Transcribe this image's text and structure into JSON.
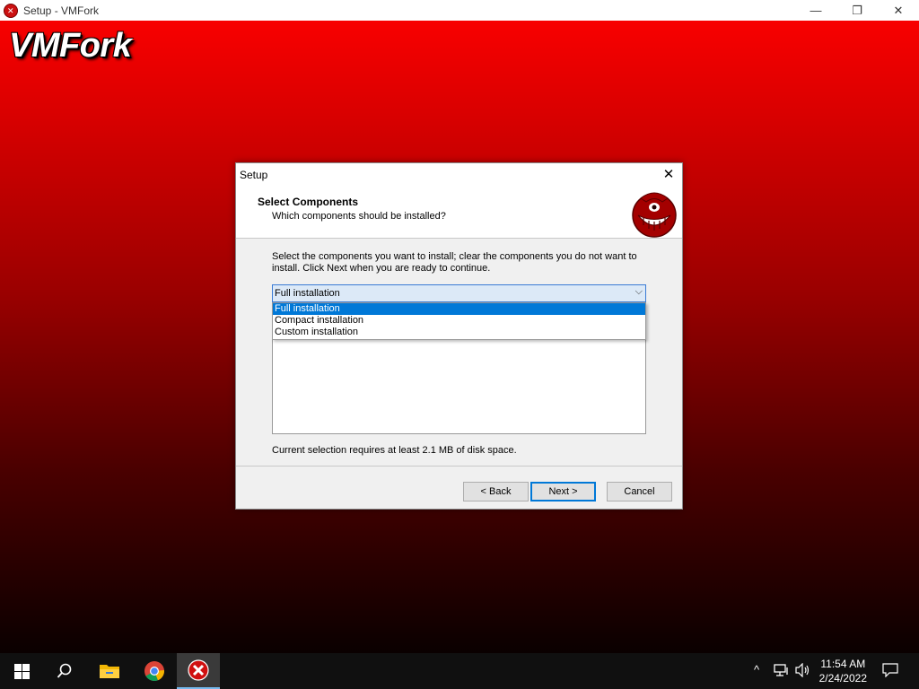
{
  "window": {
    "title": "Setup - VMFork",
    "minimize_glyph": "—",
    "restore_glyph": "❐",
    "close_glyph": "✕"
  },
  "brand": {
    "logo_text": "VMFork"
  },
  "dialog": {
    "title": "Setup",
    "close_glyph": "✕",
    "header_title": "Select Components",
    "header_subtitle": "Which components should be installed?",
    "description": "Select the components you want to install; clear the components you do not want to install. Click Next when you are ready to continue.",
    "combo_value": "Full installation",
    "combo_chevron": "⌵",
    "options": [
      "Full installation",
      "Compact installation",
      "Custom installation"
    ],
    "selected_option_index": 0,
    "disk_note": "Current selection requires at least 2.1 MB of disk space.",
    "buttons": {
      "back": "< Back",
      "next": "Next >",
      "cancel": "Cancel"
    },
    "default_button": "next"
  },
  "taskbar": {
    "icons": [
      "windows-start-icon",
      "search-icon",
      "file-explorer-icon",
      "chrome-icon",
      "setup-app-icon"
    ],
    "active_icon": "setup-app-icon",
    "tray_chevron": "^",
    "time": "11:54 AM",
    "date": "2/24/2022"
  },
  "colors": {
    "background_top": "#ff0000",
    "background_bottom": "#0a0000",
    "selection": "#0078d7",
    "taskbar": "#101010"
  }
}
